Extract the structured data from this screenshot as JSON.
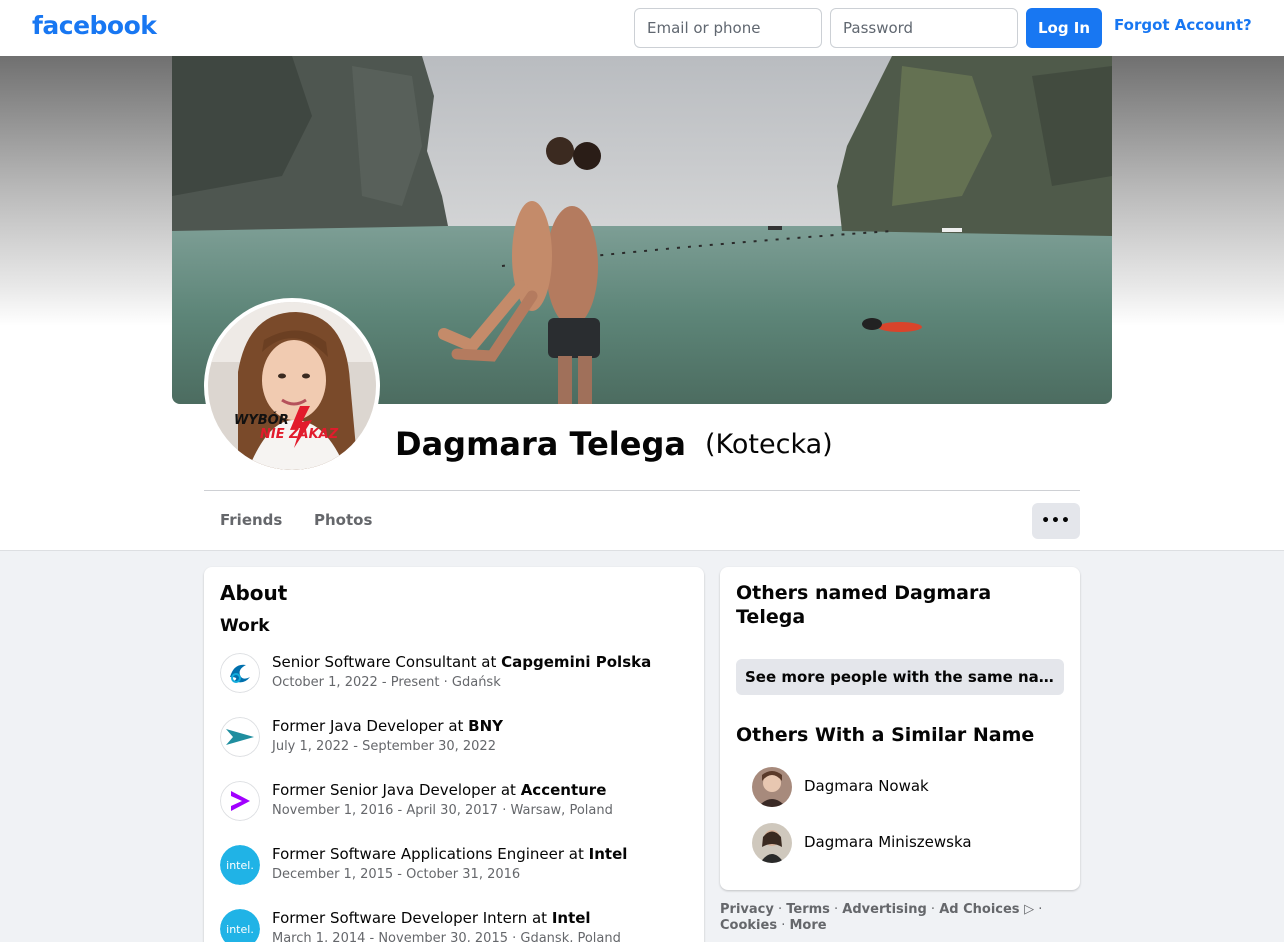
{
  "header": {
    "logo": "facebook",
    "email_placeholder": "Email or phone",
    "password_placeholder": "Password",
    "login_label": "Log In",
    "forgot_label": "Forgot Account?"
  },
  "profile": {
    "name": "Dagmara Telega",
    "alternate_name": "(Kotecka)",
    "avatar_overlay_text_1": "WYBÓR",
    "avatar_overlay_text_2": "NIE ZAKAZ",
    "tabs": [
      {
        "label": "Friends"
      },
      {
        "label": "Photos"
      }
    ],
    "more_label": "•••"
  },
  "about": {
    "title": "About",
    "work_title": "Work",
    "items": [
      {
        "prefix": "Senior Software Consultant at ",
        "company": "Capgemini Polska",
        "sub": "October 1, 2022 - Present · Gdańsk",
        "icon": "capgemini-logo-icon",
        "icon_color": "#0070ad"
      },
      {
        "prefix": "Former Java Developer at ",
        "company": "BNY",
        "sub": "July 1, 2022 - September 30, 2022",
        "icon": "bny-logo-icon",
        "icon_color": "#1f8e9f"
      },
      {
        "prefix": "Former Senior Java Developer at ",
        "company": "Accenture",
        "sub": "November 1, 2016 - April 30, 2017 · Warsaw, Poland",
        "icon": "accenture-logo-icon",
        "icon_color": "#a100ff"
      },
      {
        "prefix": "Former Software Applications Engineer at ",
        "company": "Intel",
        "sub": "December 1, 2015 - October 31, 2016",
        "icon": "intel-logo-icon",
        "icon_color": "#20b3e6"
      },
      {
        "prefix": "Former Software Developer Intern at ",
        "company": "Intel",
        "sub": "March 1, 2014 - November 30, 2015 · Gdansk, Poland",
        "icon": "intel-logo-icon",
        "icon_color": "#20b3e6"
      }
    ],
    "icon_text_intel": "intel."
  },
  "sidebar": {
    "others_named_title": "Others named Dagmara Telega",
    "see_more_label": "See more people with the same name",
    "similar_title": "Others With a Similar Name",
    "people": [
      {
        "name": "Dagmara Nowak"
      },
      {
        "name": "Dagmara Miniszewska"
      }
    ]
  },
  "footer": {
    "links": [
      "Privacy",
      "Terms",
      "Advertising",
      "Ad Choices ▷",
      "Cookies",
      "More"
    ]
  },
  "colors": {
    "brand": "#1877f2",
    "secondary_text": "#65676b",
    "button_gray": "#e4e6eb"
  }
}
